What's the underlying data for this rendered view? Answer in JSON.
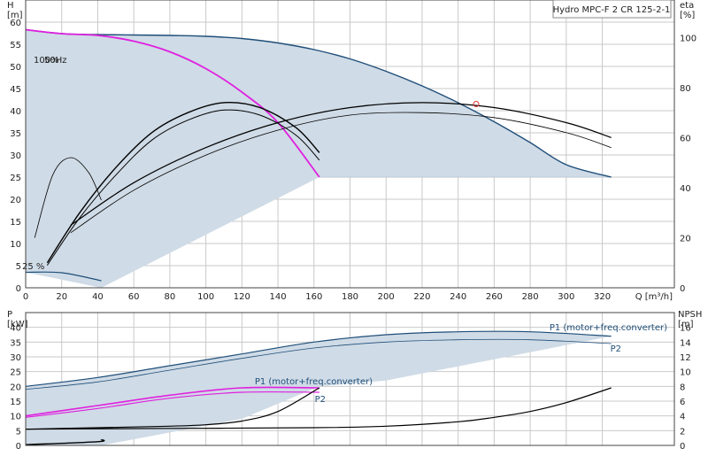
{
  "title": "Hydro MPC-F 2 CR 125-2-1",
  "colors": {
    "area": "#cfdbe6",
    "area_edge": "#a9bccd",
    "hq_full": "#1f4e79",
    "hq_reduced": "#e020e0",
    "eta": "#000000",
    "power": "#1f4e79",
    "power_small": "#e020e0",
    "npsh": "#000000",
    "grid": "#c9c9c9",
    "duty_point": "#e03030"
  },
  "labels": {
    "speed_100": "100%",
    "speed_50hz": "50Hz",
    "speed_25": "25 %",
    "p1_right": "P1 (motor+freq.converter)",
    "p2_right": "P2",
    "p1_mid": "P1 (motor+freq.converter)",
    "p2_mid": "P2"
  },
  "chart_data": [
    {
      "type": "line",
      "name": "head",
      "xlabel": "Q [m³/h]",
      "ylabel": "H\n[m]",
      "y2label": "eta\n[%]",
      "xlim": [
        0,
        360
      ],
      "ylim": [
        0,
        65
      ],
      "y2lim": [
        0,
        115
      ],
      "x_ticks": [
        0,
        20,
        40,
        60,
        80,
        100,
        120,
        140,
        160,
        180,
        200,
        220,
        240,
        260,
        280,
        300,
        320
      ],
      "y_ticks": [
        0,
        5,
        10,
        15,
        20,
        25,
        30,
        35,
        40,
        45,
        50,
        55,
        60
      ],
      "y2_ticks": [
        0,
        20,
        40,
        60,
        80,
        100
      ],
      "grid": true,
      "series": [
        {
          "label_key": "hq_full",
          "x": [
            0,
            20,
            40,
            60,
            80,
            100,
            120,
            140,
            160,
            180,
            200,
            220,
            240,
            260,
            280,
            300,
            325
          ],
          "y": [
            58.3,
            57.4,
            57.2,
            57.1,
            57.0,
            56.8,
            56.3,
            55.3,
            53.8,
            51.7,
            48.9,
            45.6,
            41.8,
            37.5,
            32.8,
            27.8,
            25.0
          ]
        },
        {
          "label_key": "hq_reduced",
          "x": [
            0,
            20,
            40,
            60,
            80,
            100,
            120,
            140,
            163
          ],
          "y": [
            58.3,
            57.4,
            57.0,
            55.7,
            53.3,
            49.5,
            44.2,
            37.3,
            25.0
          ]
        },
        {
          "label_key": "eta_single_a",
          "x": [
            12,
            30,
            50,
            70,
            90,
            110,
            130,
            150,
            163
          ],
          "y2": [
            10,
            30,
            48,
            62,
            70,
            74,
            72,
            64,
            54
          ]
        },
        {
          "label_key": "eta_single_b",
          "x": [
            12,
            30,
            50,
            70,
            90,
            110,
            130,
            150,
            163
          ],
          "y2": [
            9,
            28,
            45,
            59,
            67,
            71,
            69,
            61,
            51
          ]
        },
        {
          "label_key": "eta_system_a",
          "x": [
            25,
            60,
            100,
            140,
            180,
            220,
            260,
            300,
            325
          ],
          "y2": [
            25,
            42,
            56,
            66,
            72,
            74,
            72,
            66,
            60
          ]
        },
        {
          "label_key": "eta_system_b",
          "x": [
            25,
            60,
            100,
            140,
            180,
            220,
            260,
            300,
            325
          ],
          "y2": [
            22,
            39,
            53,
            63,
            69,
            70,
            68,
            62,
            56
          ]
        },
        {
          "label_key": "eta_25",
          "x": [
            5,
            15,
            25,
            35,
            42
          ],
          "y2": [
            20,
            45,
            52,
            46,
            35
          ]
        }
      ],
      "duty_point": {
        "x": 250,
        "y": 41.5
      },
      "envelope": {
        "x_min": 0,
        "x_max": 325,
        "h_min": 25
      }
    },
    {
      "type": "line",
      "name": "power_npsh",
      "ylabel": "P\n[kW]",
      "y2label": "NPSH\n[m]",
      "xlim": [
        0,
        360
      ],
      "ylim": [
        0,
        45
      ],
      "y2lim": [
        0,
        18
      ],
      "y_ticks": [
        0,
        5,
        10,
        15,
        20,
        25,
        30,
        35,
        40
      ],
      "y2_ticks": [
        0,
        2,
        4,
        6,
        8,
        10,
        12,
        14,
        16
      ],
      "grid": true,
      "series": [
        {
          "label_key": "p1_right",
          "x": [
            0,
            40,
            80,
            120,
            160,
            200,
            240,
            280,
            325
          ],
          "y": [
            20,
            23,
            27,
            31,
            35,
            37.5,
            38.5,
            38.5,
            37
          ]
        },
        {
          "label_key": "p2_right",
          "x": [
            0,
            40,
            80,
            120,
            160,
            200,
            240,
            280,
            325
          ],
          "y": [
            19,
            21.5,
            25.5,
            29.5,
            33,
            35,
            35.8,
            35.8,
            34.5
          ]
        },
        {
          "label_key": "p1_mid",
          "x": [
            0,
            40,
            80,
            120,
            163
          ],
          "y": [
            10,
            13.5,
            17,
            19.5,
            19.5
          ]
        },
        {
          "label_key": "p2_mid",
          "x": [
            0,
            40,
            80,
            120,
            163
          ],
          "y": [
            9.5,
            12.5,
            16,
            18,
            18
          ]
        },
        {
          "label_key": "npsh_single",
          "x": [
            0,
            40,
            80,
            100,
            120,
            140,
            163
          ],
          "y2": [
            2.2,
            2.4,
            2.6,
            2.8,
            3.3,
            4.6,
            7.8
          ]
        },
        {
          "label_key": "npsh_system",
          "x": [
            0,
            80,
            160,
            200,
            240,
            260,
            280,
            300,
            325
          ],
          "y2": [
            2.2,
            2.3,
            2.4,
            2.6,
            3.2,
            3.8,
            4.6,
            5.8,
            7.8
          ]
        },
        {
          "label_key": "npsh_low",
          "x": [
            0,
            40,
            42
          ],
          "y2": [
            0.1,
            0.5,
            0.8
          ]
        }
      ]
    }
  ]
}
